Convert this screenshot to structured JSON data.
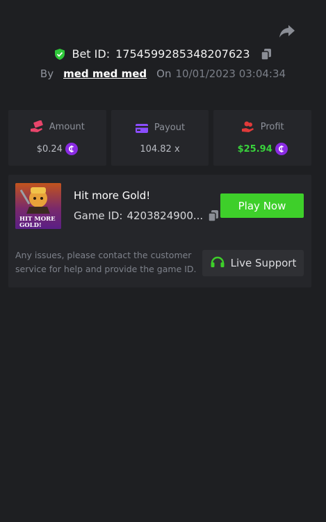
{
  "bet": {
    "id_label": "Bet ID:",
    "id_value": "1754599285348207623",
    "by_label": "By",
    "username": "med med med",
    "on_label": "On",
    "datetime": "10/01/2023 03:04:34"
  },
  "stats": {
    "amount": {
      "label": "Amount",
      "value": "$0.24",
      "icon": "money-hand-icon",
      "color": "#e8456b"
    },
    "payout": {
      "label": "Payout",
      "value": "104.82 x",
      "icon": "card-icon",
      "color": "#8b4dff"
    },
    "profit": {
      "label": "Profit",
      "value": "$25.94",
      "icon": "coins-hand-icon",
      "color": "#e03a3a"
    }
  },
  "game": {
    "title": "Hit more Gold!",
    "id_label": "Game ID:",
    "id_value": "4203824900...",
    "thumb_text_line1": "HIT MORE",
    "thumb_text_line2": "GOLD!",
    "play_label": "Play Now"
  },
  "support": {
    "text": "Any issues, please contact the customer service for help and provide the game ID.",
    "button_label": "Live Support"
  },
  "colors": {
    "accent_green": "#3ecf2a",
    "profit_green": "#39d23c",
    "coin_purple": "#8a2be2",
    "background": "#1e1f22",
    "card": "#25262a"
  }
}
